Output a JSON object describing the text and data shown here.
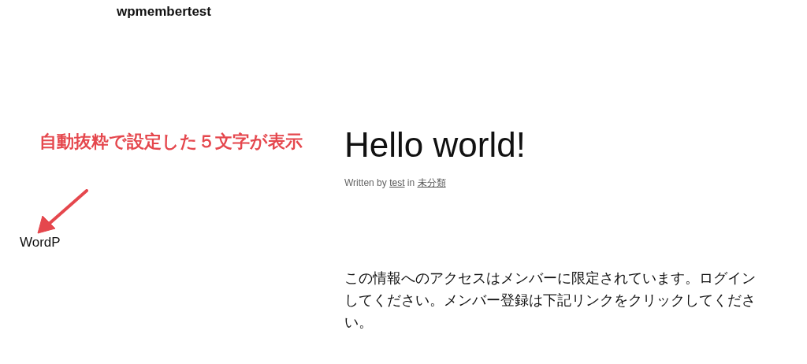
{
  "site_title": "wpmembertest",
  "annotation": {
    "text": "自動抜粋で設定した５文字が表示"
  },
  "excerpt": "WordP",
  "post": {
    "title": "Hello world!",
    "meta": {
      "prefix": "Written by",
      "author": "test",
      "middle": "in",
      "category": "未分類"
    },
    "body": "この情報へのアクセスはメンバーに限定されています。ログインしてください。メンバー登録は下記リンクをクリックしてください。"
  }
}
